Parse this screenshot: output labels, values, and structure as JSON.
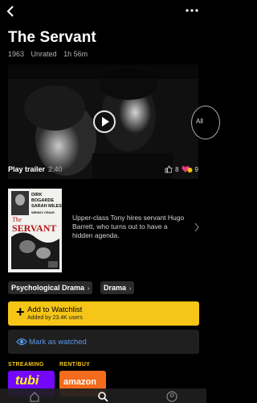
{
  "header": {
    "back_icon": "chevron-left-icon",
    "more_icon": "ellipsis-icon"
  },
  "movie": {
    "title": "The Servant",
    "year": "1963",
    "rating": "Unrated",
    "runtime": "1h 56m"
  },
  "trailer": {
    "label": "Play trailer",
    "duration": "2:40",
    "all_label": "All"
  },
  "reactions": {
    "likes": "8",
    "loves": "9"
  },
  "poster": {
    "cast": [
      "DIRK BOGARDE",
      "SARAH MILES",
      "WENDY CRAIG"
    ],
    "title_small": "The",
    "title_big": "SERVANT"
  },
  "description": "Upper-class Tony hires servant Hugo Barrett, who turns out to have a hidden agenda.",
  "genres": [
    "Psychological Drama",
    "Drama"
  ],
  "watchlist": {
    "label": "Add to Watchlist",
    "sub": "Added by 23.4K users"
  },
  "watched": {
    "label": "Mark as watched"
  },
  "services": {
    "streaming_label": "STREAMING",
    "rent_label": "RENT/BUY",
    "streaming_name": "tubi",
    "rent_name": "amazon"
  },
  "colors": {
    "accent": "#f5c518",
    "link": "#5799ef"
  }
}
